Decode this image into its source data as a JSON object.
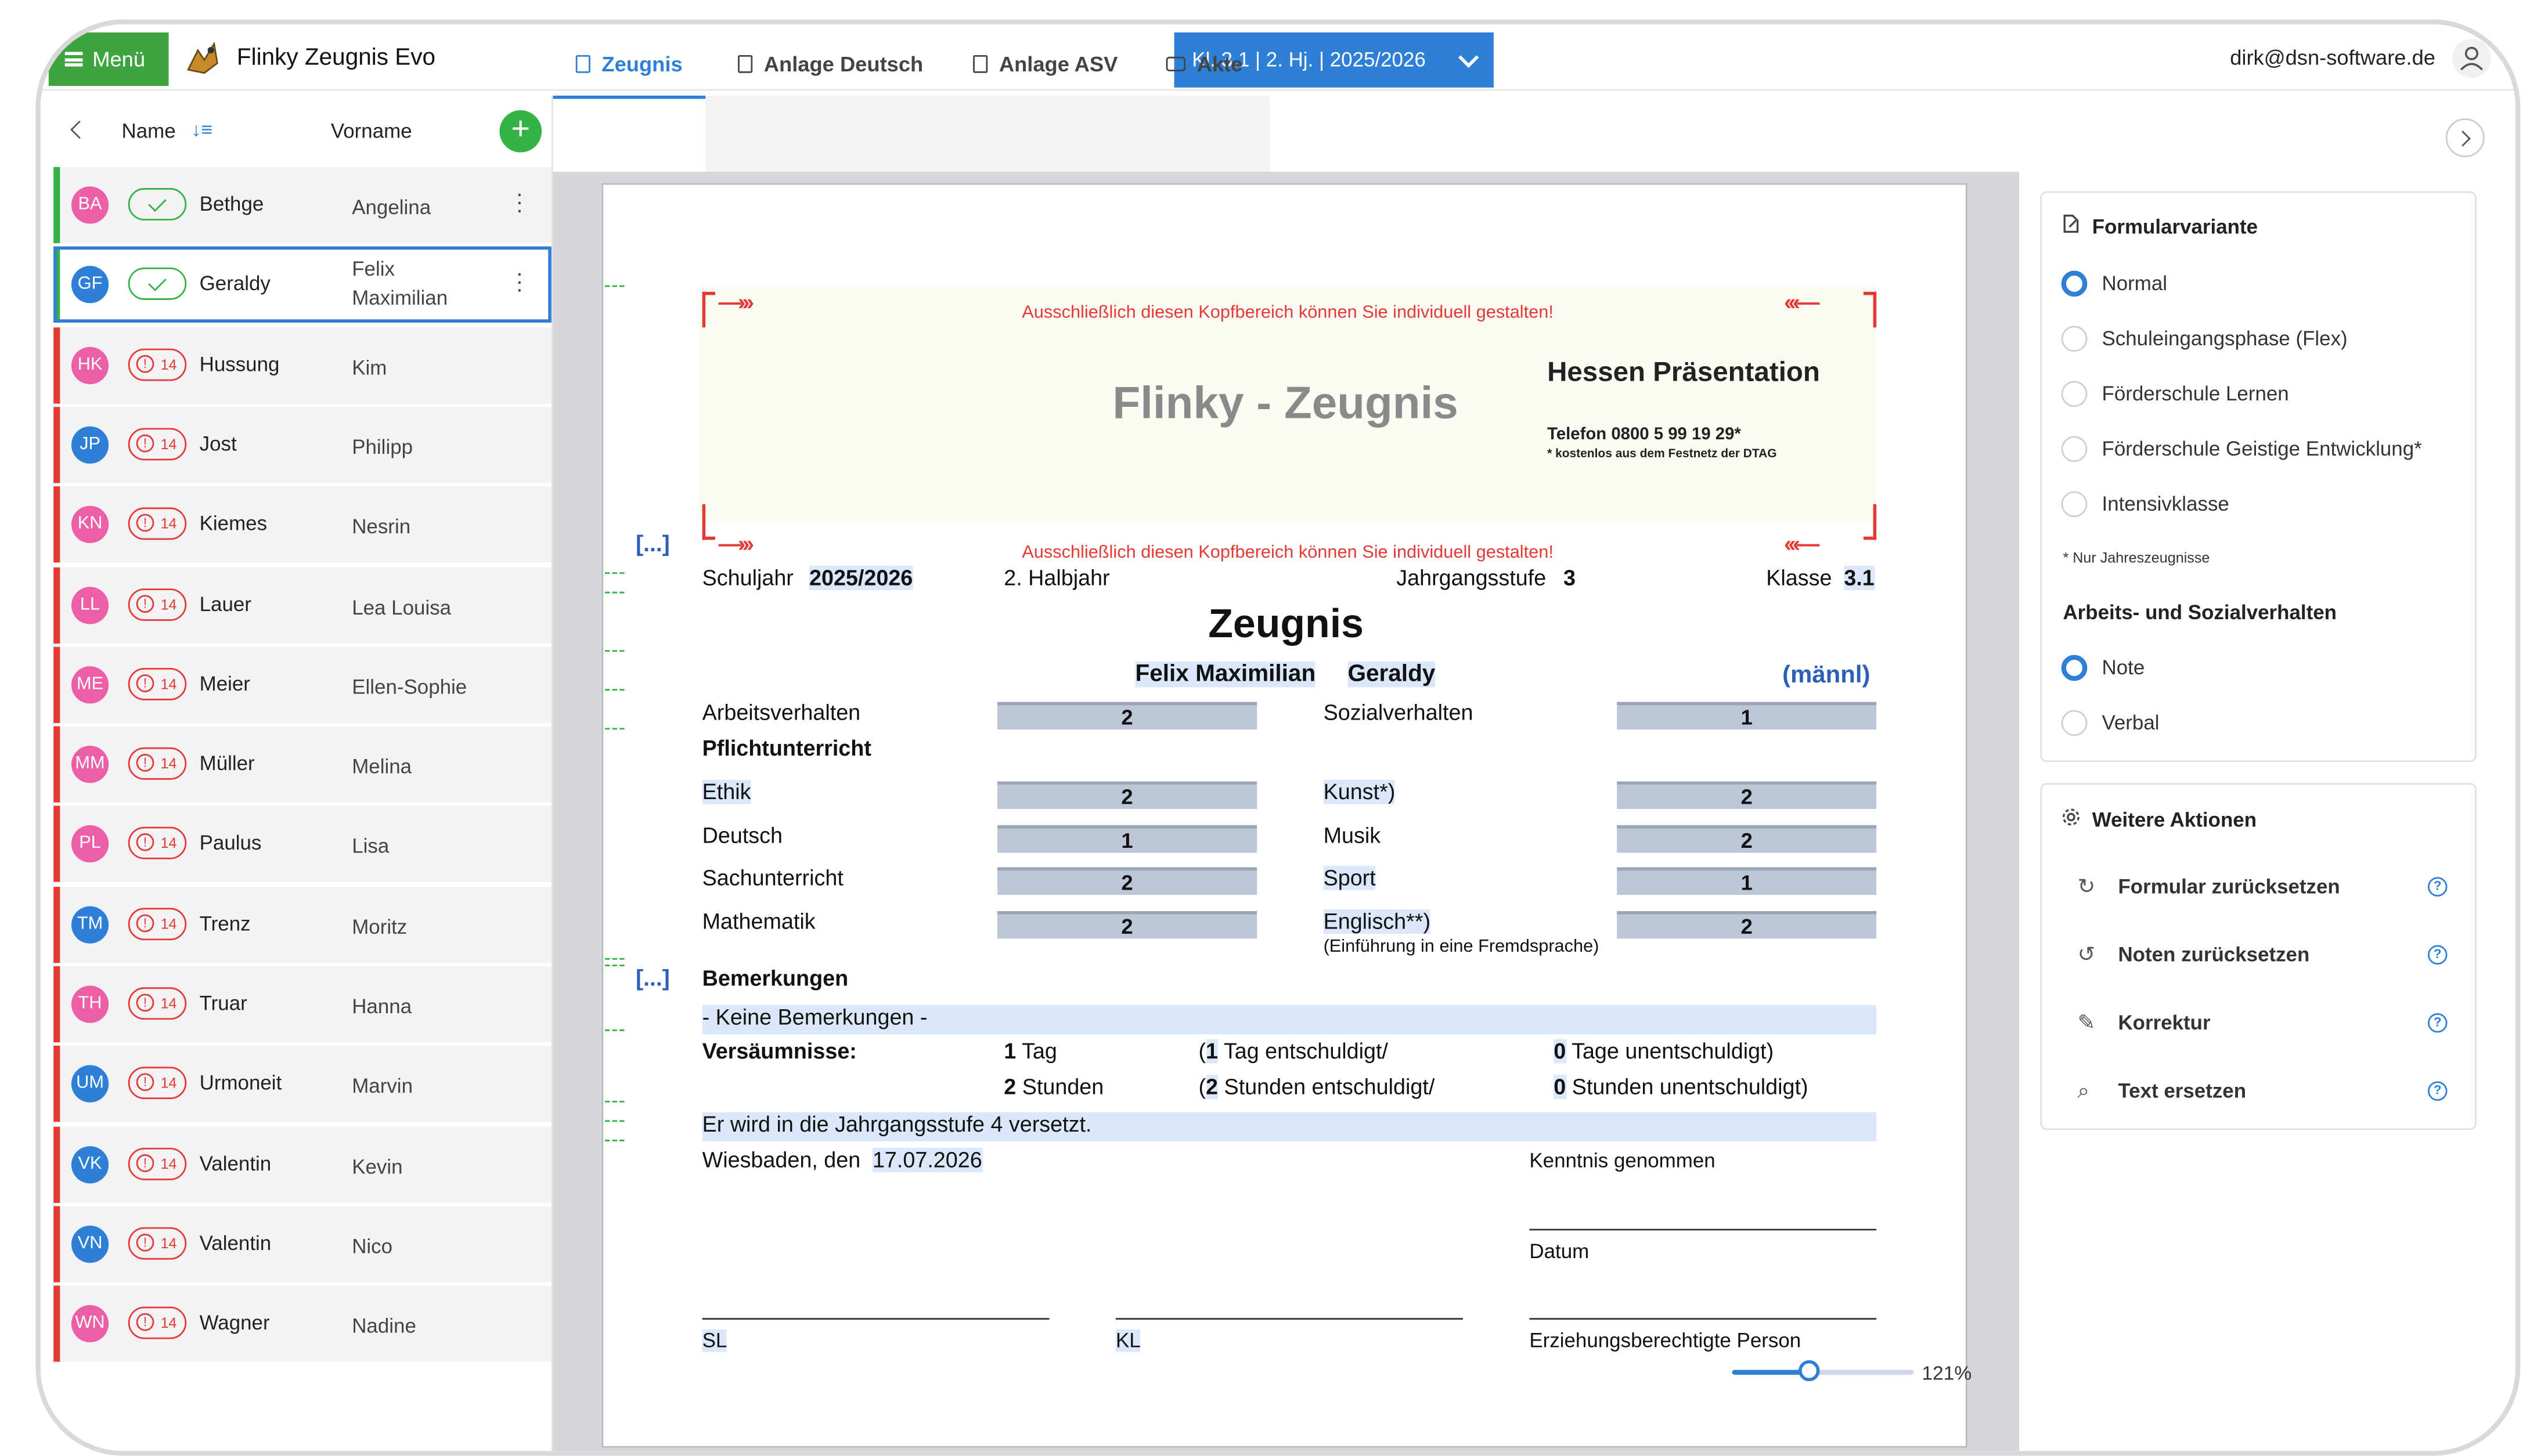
{
  "topbar": {
    "menu_label": "Menü",
    "app_title": "Flinky Zeugnis Evo",
    "class_selector": "Kl. 3.1 | 2. Hj. | 2025/2026",
    "user_email": "dirk@dsn-software.de"
  },
  "list": {
    "col_name": "Name",
    "col_vorname": "Vorname",
    "add_label": "+",
    "rows": [
      {
        "initials": "BA",
        "name": "Bethge",
        "vorname": "Angelina",
        "status": "ok",
        "avatar_color": "#ec5fa6"
      },
      {
        "initials": "GF",
        "name": "Geraldy",
        "vorname": "Felix",
        "vorname2": "Maximilian",
        "status": "ok",
        "avatar_color": "#2e7fd6"
      },
      {
        "initials": "HK",
        "name": "Hussung",
        "vorname": "Kim",
        "status": "14",
        "avatar_color": "#ec5fa6"
      },
      {
        "initials": "JP",
        "name": "Jost",
        "vorname": "Philipp",
        "status": "14",
        "avatar_color": "#2e7fd6"
      },
      {
        "initials": "KN",
        "name": "Kiemes",
        "vorname": "Nesrin",
        "status": "14",
        "avatar_color": "#ec5fa6"
      },
      {
        "initials": "LL",
        "name": "Lauer",
        "vorname": "Lea Louisa",
        "status": "14",
        "avatar_color": "#ec5fa6"
      },
      {
        "initials": "ME",
        "name": "Meier",
        "vorname": "Ellen-Sophie",
        "status": "14",
        "avatar_color": "#ec5fa6"
      },
      {
        "initials": "MM",
        "name": "Müller",
        "vorname": "Melina",
        "status": "14",
        "avatar_color": "#ec5fa6"
      },
      {
        "initials": "PL",
        "name": "Paulus",
        "vorname": "Lisa",
        "status": "14",
        "avatar_color": "#ec5fa6"
      },
      {
        "initials": "TM",
        "name": "Trenz",
        "vorname": "Moritz",
        "status": "14",
        "avatar_color": "#2e7fd6"
      },
      {
        "initials": "TH",
        "name": "Truar",
        "vorname": "Hanna",
        "status": "14",
        "avatar_color": "#ec5fa6"
      },
      {
        "initials": "UM",
        "name": "Urmoneit",
        "vorname": "Marvin",
        "status": "14",
        "avatar_color": "#2e7fd6"
      },
      {
        "initials": "VK",
        "name": "Valentin",
        "vorname": "Kevin",
        "status": "14",
        "avatar_color": "#2e7fd6"
      },
      {
        "initials": "VN",
        "name": "Valentin",
        "vorname": "Nico",
        "status": "14",
        "avatar_color": "#2e7fd6"
      },
      {
        "initials": "WN",
        "name": "Wagner",
        "vorname": "Nadine",
        "status": "14",
        "avatar_color": "#ec5fa6"
      }
    ]
  },
  "tabs": [
    "Zeugnis",
    "Anlage Deutsch",
    "Anlage ASV",
    "Akte"
  ],
  "doc": {
    "header_note": "Ausschließlich diesen Kopfbereich können Sie individuell gestalten!",
    "flinky_title": "Flinky - Zeugnis",
    "school_name": "Hessen Präsentation",
    "phone": "Telefon 0800 5 99 19 29*",
    "phone_note": "* kostenlos aus dem Festnetz der DTAG",
    "ellipsis": "[...]",
    "schuljahr_label": "Schuljahr",
    "schuljahr": "2025/2026",
    "halbjahr": "2. Halbjahr",
    "jahrgang_label": "Jahrgangsstufe",
    "jahrgang": "3",
    "klasse_label": "Klasse",
    "klasse": "3.1",
    "title": "Zeugnis",
    "student_vorname": "Felix Maximilian",
    "student_name": "Geraldy",
    "gender": "(männl)",
    "arbeitsverhalten_label": "Arbeitsverhalten",
    "arbeitsverhalten": "2",
    "sozialverhalten_label": "Sozialverhalten",
    "sozialverhalten": "1",
    "pflicht_label": "Pflichtunterricht",
    "subjects_left": [
      {
        "name": "Ethik",
        "grade": "2"
      },
      {
        "name": "Deutsch",
        "grade": "1"
      },
      {
        "name": "Sachunterricht",
        "grade": "2"
      },
      {
        "name": "Mathematik",
        "grade": "2"
      }
    ],
    "subjects_right": [
      {
        "name": "Kunst*)",
        "grade": "2"
      },
      {
        "name": "Musik",
        "grade": "2"
      },
      {
        "name": "Sport",
        "grade": "1"
      },
      {
        "name": "Englisch**)",
        "grade": "2"
      }
    ],
    "englisch_note": "(Einführung in eine Fremdsprache)",
    "bemerkungen_label": "Bemerkungen",
    "bemerkungen": "- Keine Bemerkungen -",
    "versaeumnisse_label": "Versäumnisse:",
    "tage_num": "1",
    "tage_label": "Tag",
    "tage_ent_open": "(",
    "tage_ent_num": "1",
    "tage_ent_label": "Tag entschuldigt/",
    "tage_unent_num": "0",
    "tage_unent_label": "Tage unentschuldigt)",
    "stunden_num": "2",
    "stunden_label": "Stunden",
    "stunden_ent_num": "2",
    "stunden_ent_label": "Stunden entschuldigt/",
    "stunden_unent_num": "0",
    "stunden_unent_label": "Stunden unentschuldigt)",
    "versetzung": "Er wird in die Jahrgangsstufe 4 versetzt.",
    "ort_datum_prefix": "Wiesbaden, den",
    "datum": "17.07.2026",
    "kenntnis": "Kenntnis genommen",
    "datum_label": "Datum",
    "sl": "SL",
    "kl": "KL",
    "erz": "Erziehungsberechtigte Person"
  },
  "zoom": {
    "label": "121%",
    "fraction": 0.42
  },
  "panel": {
    "formular_title": "Formularvariante",
    "formular_options": [
      "Normal",
      "Schuleingangsphase (Flex)",
      "Förderschule Lernen",
      "Förderschule Geistige Entwicklung*",
      "Intensivklasse"
    ],
    "formular_selected": 0,
    "note_only_year": "* Nur Jahreszeugnisse",
    "asv_title": "Arbeits- und Sozialverhalten",
    "asv_options": [
      "Note",
      "Verbal"
    ],
    "asv_selected": 0,
    "actions_title": "Weitere Aktionen",
    "actions": [
      "Formular zurücksetzen",
      "Noten zurücksetzen",
      "Korrektur",
      "Text ersetzen"
    ]
  }
}
